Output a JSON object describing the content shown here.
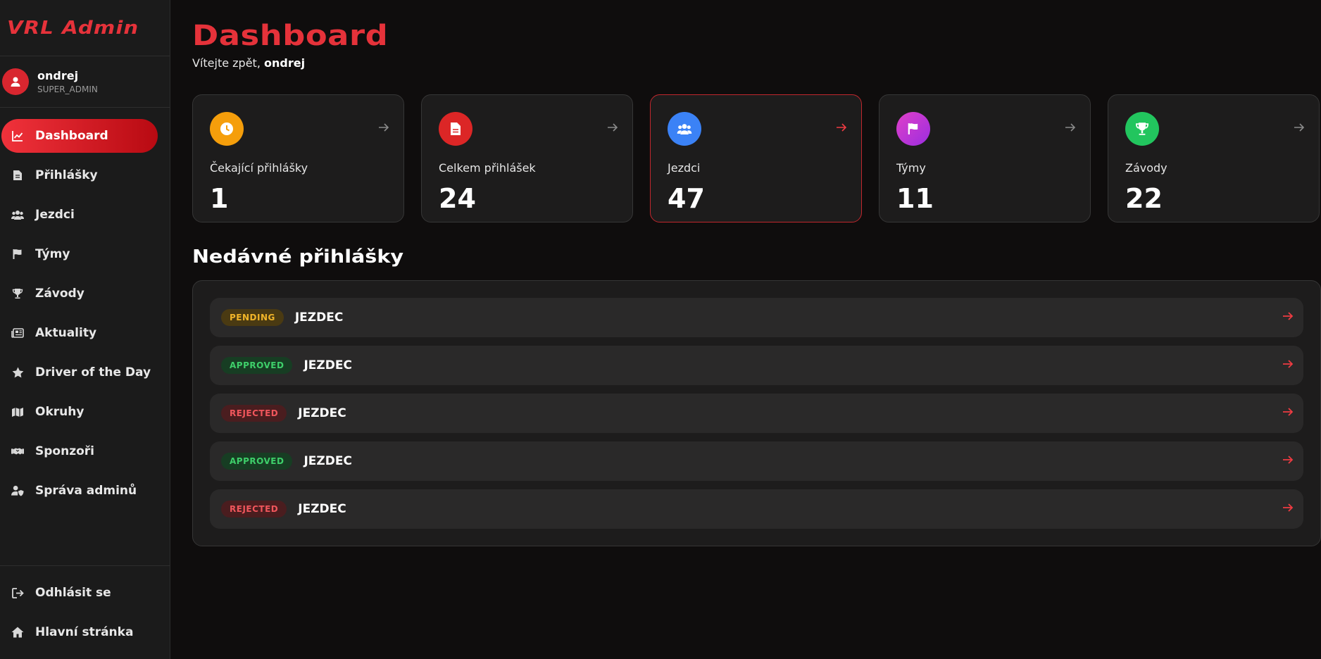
{
  "brand": "VRL Admin",
  "user": {
    "name": "ondrej",
    "role": "SUPER_ADMIN"
  },
  "nav": [
    {
      "label": "Dashboard",
      "icon": "chart-line-icon",
      "active": true
    },
    {
      "label": "Přihlášky",
      "icon": "document-icon"
    },
    {
      "label": "Jezdci",
      "icon": "users-icon"
    },
    {
      "label": "Týmy",
      "icon": "flag-icon"
    },
    {
      "label": "Závody",
      "icon": "trophy-icon"
    },
    {
      "label": "Aktuality",
      "icon": "newspaper-icon"
    },
    {
      "label": "Driver of the Day",
      "icon": "star-icon"
    },
    {
      "label": "Okruhy",
      "icon": "map-icon"
    },
    {
      "label": "Sponzoři",
      "icon": "handshake-icon"
    },
    {
      "label": "Správa adminů",
      "icon": "user-shield-icon"
    }
  ],
  "nav_bottom": [
    {
      "label": "Odhlásit se",
      "icon": "logout-icon"
    },
    {
      "label": "Hlavní stránka",
      "icon": "home-icon"
    }
  ],
  "page": {
    "title": "Dashboard",
    "welcome_prefix": "Vítejte zpět,",
    "welcome_user": "ondrej"
  },
  "cards": [
    {
      "label": "Čekající přihlášky",
      "value": "1",
      "icon": "clock-icon",
      "color": "#f59e0b"
    },
    {
      "label": "Celkem přihlášek",
      "value": "24",
      "icon": "document-icon",
      "color": "#dc2626"
    },
    {
      "label": "Jezdci",
      "value": "47",
      "icon": "users-icon",
      "color": "#3b82f6"
    },
    {
      "label": "Týmy",
      "value": "11",
      "icon": "flag-icon",
      "color": "#c026d3"
    },
    {
      "label": "Závody",
      "value": "22",
      "icon": "trophy-icon",
      "color": "#22c55e"
    }
  ],
  "recent": {
    "title": "Nedávné přihlášky",
    "rows": [
      {
        "status": "PENDING",
        "name": "JEZDEC"
      },
      {
        "status": "APPROVED",
        "name": "JEZDEC"
      },
      {
        "status": "REJECTED",
        "name": "JEZDEC"
      },
      {
        "status": "APPROVED",
        "name": "JEZDEC"
      },
      {
        "status": "REJECTED",
        "name": "JEZDEC"
      }
    ]
  },
  "colors": {
    "accent": "#e5323a",
    "background": "#0f0d0d",
    "surface": "#1d1c1c"
  }
}
